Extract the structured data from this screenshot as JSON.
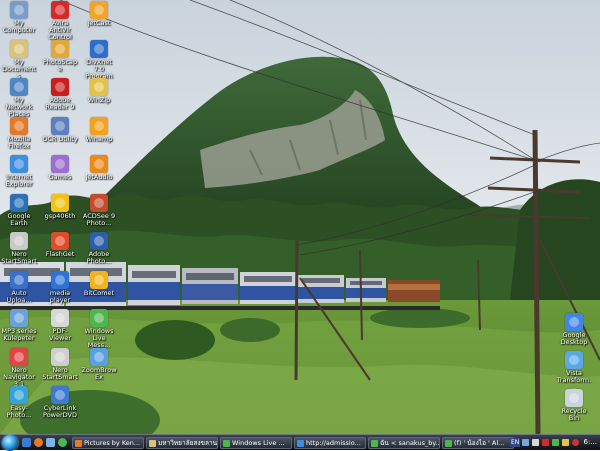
{
  "desktop": {
    "left_icons": [
      {
        "label": "My Computer",
        "icon": "computer-icon",
        "color": "#7a9cc6"
      },
      {
        "label": "My Documents",
        "icon": "documents-folder-icon",
        "color": "#d9c27a"
      },
      {
        "label": "My Network Places",
        "icon": "network-icon",
        "color": "#4f86c6"
      },
      {
        "label": "Mozilla Firefox",
        "icon": "firefox-icon",
        "color": "#e5792a"
      },
      {
        "label": "Internet Explorer",
        "icon": "internet-explorer-icon",
        "color": "#3d8de0"
      },
      {
        "label": "Google Earth",
        "icon": "google-earth-icon",
        "color": "#2b6fb6"
      },
      {
        "label": "Nero StartSmart",
        "icon": "nero-icon",
        "color": "#c8c8c8"
      },
      {
        "label": "Auto Uploa...",
        "icon": "upload-icon",
        "color": "#3a70c9"
      },
      {
        "label": "MP3 series Kulepeter",
        "icon": "media-file-icon",
        "color": "#6aa2d8"
      },
      {
        "label": "Nero Navigator 3.1",
        "icon": "nero-navigator-icon",
        "color": "#e04545"
      },
      {
        "label": "Easy-Photo...",
        "icon": "photo-icon",
        "color": "#35a3d9"
      }
    ],
    "mid_icons": [
      {
        "label": "Avira AntiVir Control Ce...",
        "icon": "antivirus-icon",
        "color": "#d62a2a"
      },
      {
        "label": "PhotoScape",
        "icon": "photoscape-icon",
        "color": "#e0a93a"
      },
      {
        "label": "Adobe Reader 9",
        "icon": "adobe-reader-icon",
        "color": "#c81e1e"
      },
      {
        "label": "OCR Utility",
        "icon": "ocr-icon",
        "color": "#5b7fbf"
      },
      {
        "label": "Games",
        "icon": "games-icon",
        "color": "#9a6fd0"
      },
      {
        "label": "gsp406th",
        "icon": "gsp-icon",
        "color": "#f2c21b"
      },
      {
        "label": "FlashGet",
        "icon": "flashget-icon",
        "color": "#e04b2a"
      },
      {
        "label": "media player",
        "icon": "media-player-icon",
        "color": "#2d74d6"
      },
      {
        "label": "PDF-Viewer",
        "icon": "pdf-viewer-icon",
        "color": "#d7d7d7"
      },
      {
        "label": "Nero StartSmart",
        "icon": "nero-startsmart-icon",
        "color": "#cfcfcf"
      },
      {
        "label": "CyberLink PowerDVD",
        "icon": "powerdvd-icon",
        "color": "#3f7ad1"
      }
    ],
    "right_icons": [
      {
        "label": "jetCast",
        "icon": "jetcast-icon",
        "color": "#f0a52a"
      },
      {
        "label": "DivXnet 7.0 Program",
        "icon": "divx-icon",
        "color": "#2f6ec6"
      },
      {
        "label": "WinZip",
        "icon": "winzip-icon",
        "color": "#e3c24a"
      },
      {
        "label": "Winamp",
        "icon": "winamp-icon",
        "color": "#f4a11e"
      },
      {
        "label": "jetAudio",
        "icon": "jetaudio-icon",
        "color": "#e88a1c"
      },
      {
        "label": "ACDSee 9 Photo...",
        "icon": "acdsee-icon",
        "color": "#c44b2b"
      },
      {
        "label": "Adobe Photo...",
        "icon": "photoshop-icon",
        "color": "#2d5ea8"
      },
      {
        "label": "BitComet",
        "icon": "bitcomet-icon",
        "color": "#f0b41e"
      },
      {
        "label": "Windows Live Mess...",
        "icon": "messenger-icon",
        "color": "#4fb54f"
      },
      {
        "label": "ZoomBrow Ex",
        "icon": "zoombrowser-icon",
        "color": "#5aa0e0"
      }
    ],
    "far_right_icons": [
      {
        "label": "Google Desktop",
        "icon": "google-desktop-icon",
        "color": "#3f86e8"
      },
      {
        "label": "Vista Transform...",
        "icon": "vista-transform-icon",
        "color": "#5aa9e6"
      },
      {
        "label": "Recycle Bin",
        "icon": "recycle-bin-icon",
        "color": "#c9d4df"
      }
    ]
  },
  "taskbar": {
    "buttons": [
      {
        "label": "Pictures by Ken...",
        "icon": "firefox-icon",
        "color": "#e5792a"
      },
      {
        "label": "มหาวิทยาลัยสงขลาน...",
        "icon": "folder-icon",
        "color": "#d9c27a"
      },
      {
        "label": "Windows Live ...",
        "icon": "messenger-icon",
        "color": "#4fb54f"
      },
      {
        "label": "http://admissio...",
        "icon": "internet-explorer-icon",
        "color": "#3d8de0"
      },
      {
        "label": "ฉัน < sanakus_by...",
        "icon": "messenger-icon",
        "color": "#4fb54f"
      },
      {
        "label": "(f) ' น้องไอ ' Al...",
        "icon": "messenger-icon",
        "color": "#4fb54f"
      }
    ],
    "language": "EN",
    "clock": "6:..."
  }
}
